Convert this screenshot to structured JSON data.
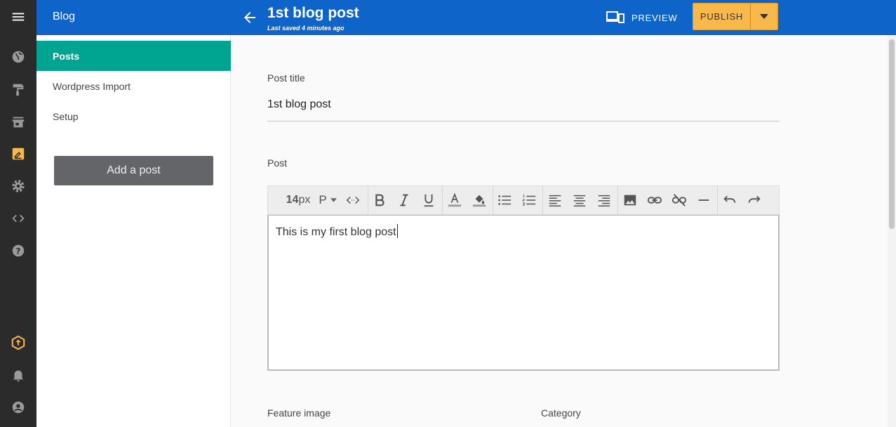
{
  "rail": {
    "icons": [
      "globe-icon",
      "paint-roller-icon",
      "store-icon",
      "blog-edit-icon",
      "gear-icon",
      "code-icon",
      "help-icon",
      "upgrade-icon",
      "bell-icon",
      "account-icon"
    ],
    "active_color": "#f9b94a"
  },
  "topbar": {
    "section_title": "Blog",
    "post_title": "1st blog post",
    "last_saved": "Last saved 4 minutes ago",
    "preview_label": "PREVIEW",
    "publish_label": "PUBLISH",
    "background_color": "#0e64c8"
  },
  "sidebar": {
    "items": [
      {
        "label": "Posts",
        "active": true
      },
      {
        "label": "Wordpress Import",
        "active": false
      },
      {
        "label": "Setup",
        "active": false
      }
    ],
    "add_post_label": "Add a post",
    "active_color": "#00a591"
  },
  "form": {
    "post_title_label": "Post title",
    "post_title_value": "1st blog post",
    "post_label": "Post",
    "editor_content": "This is my first blog post",
    "feature_image_label": "Feature image",
    "category_label": "Category"
  },
  "toolbar": {
    "font_size_value": "14",
    "font_size_unit": " px",
    "paragraph_label": "P"
  }
}
